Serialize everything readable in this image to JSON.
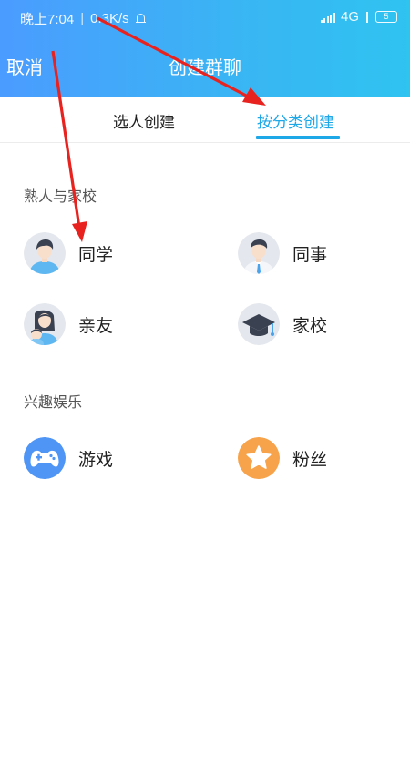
{
  "status_bar": {
    "time": "晚上7:04",
    "network_speed": "0.3K/s",
    "network_type": "4G",
    "battery": "5"
  },
  "nav": {
    "cancel_label": "取消",
    "title": "创建群聊"
  },
  "tabs": [
    {
      "label": "选人创建",
      "active": false
    },
    {
      "label": "按分类创建",
      "active": true
    }
  ],
  "sections": [
    {
      "title": "熟人与家校",
      "items": [
        {
          "label": "同学",
          "icon": "classmate-avatar-icon"
        },
        {
          "label": "同事",
          "icon": "colleague-avatar-icon"
        },
        {
          "label": "亲友",
          "icon": "friends-family-avatar-icon"
        },
        {
          "label": "家校",
          "icon": "graduation-cap-icon"
        }
      ]
    },
    {
      "title": "兴趣娱乐",
      "items": [
        {
          "label": "游戏",
          "icon": "gamepad-icon"
        },
        {
          "label": "粉丝",
          "icon": "star-icon"
        }
      ]
    }
  ],
  "colors": {
    "header_gradient_start": "#4b9cff",
    "header_gradient_end": "#2fc3f0",
    "accent": "#1fa8e8",
    "annotation_arrow": "#e8231f",
    "game_icon_bg": "#4f95f5",
    "fans_icon_bg": "#f7a34b"
  }
}
